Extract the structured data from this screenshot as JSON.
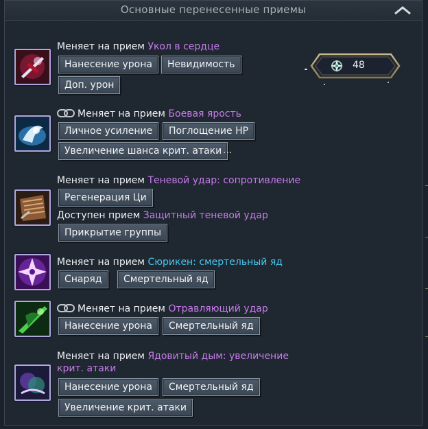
{
  "header": {
    "title": "Основные перенесенные приемы"
  },
  "counter": {
    "value": "48"
  },
  "rows": [
    {
      "line1": {
        "prefix": "Меняет на прием ",
        "skill": "Укол в сердце"
      },
      "tags": [
        "Нанесение урона",
        "Невидимость",
        "Доп. урон"
      ]
    },
    {
      "line1": {
        "prefix": "Меняет на прием ",
        "skill": "Боевая ярость"
      },
      "tags": [
        "Личное усиление",
        "Поглощение HP",
        "Увеличение шанса крит. атаки"
      ],
      "ellipsis": "..."
    },
    {
      "line1": {
        "prefix": "Меняет на прием ",
        "skill": "Теневой удар: сопротивление"
      },
      "tags": [
        "Регенерация Ци"
      ],
      "line2": {
        "prefix": "Доступен прием ",
        "skill": "Защитный теневой удар"
      },
      "tags2": [
        "Прикрытие группы"
      ]
    },
    {
      "line1": {
        "prefix": "Меняет на прием ",
        "skill": "Сюрикен: смертельный яд"
      },
      "tags": [
        "Снаряд",
        "Смертельный яд"
      ]
    },
    {
      "line1": {
        "prefix": "Меняет на прием ",
        "skill": "Отравляющий удар"
      },
      "tags": [
        "Нанесение урона",
        "Смертельный яд"
      ]
    },
    {
      "line1": {
        "prefix": "Меняет на прием ",
        "skill": "Ядовитый дым: увеличение крит. атаки"
      },
      "tags": [
        "Нанесение урона",
        "Смертельный яд",
        "Увеличение крит. атаки"
      ]
    }
  ]
}
